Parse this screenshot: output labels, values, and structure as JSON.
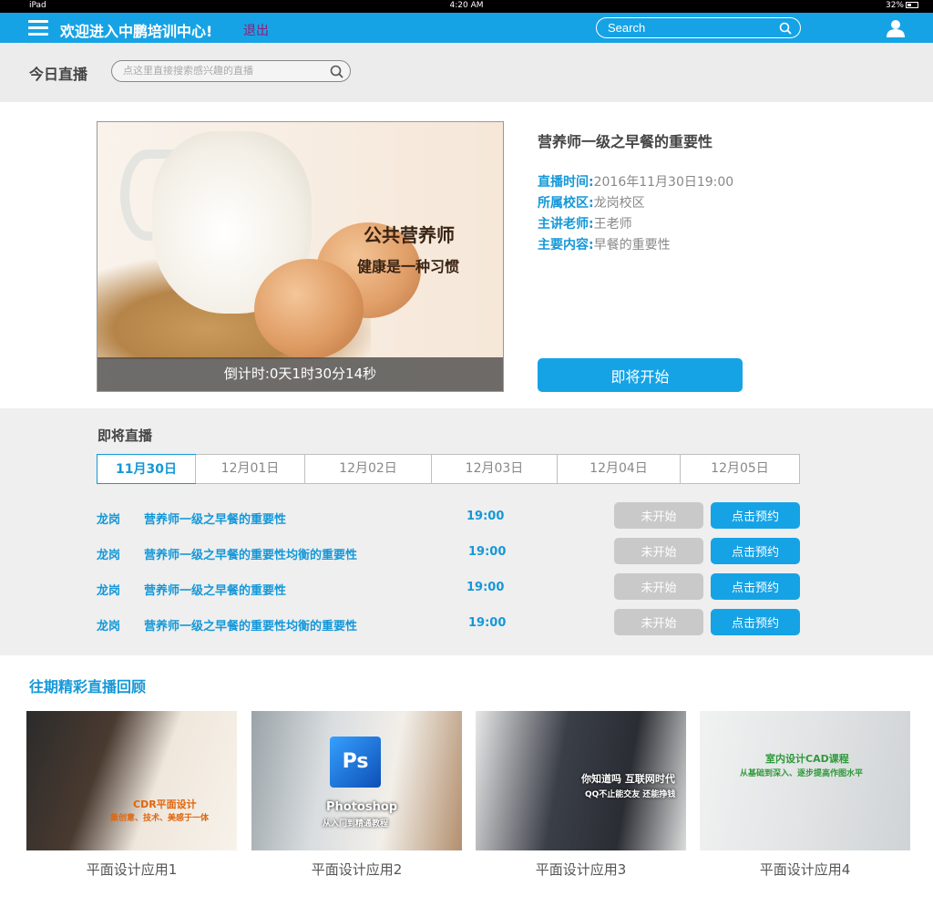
{
  "status_bar": {
    "device": "iPad",
    "time": "4:20 AM",
    "battery": "32%"
  },
  "topnav": {
    "welcome": "欢迎进入中鹏培训中心!",
    "logout": "退出",
    "search_placeholder": "Search"
  },
  "live_search": {
    "title": "今日直播",
    "placeholder": "点这里直接搜索感兴趣的直播"
  },
  "featured": {
    "poster_headline": "公共营养师",
    "poster_subline": "健康是一种习惯",
    "countdown": "倒计时:0天1时30分14秒",
    "title": "营养师一级之早餐的重要性",
    "rows": [
      {
        "key": "直播时间:",
        "value": "2016年11月30日19:00"
      },
      {
        "key": "所属校区:",
        "value": "龙岗校区"
      },
      {
        "key": "主讲老师:",
        "value": "王老师"
      },
      {
        "key": "主要内容:",
        "value": "早餐的重要性"
      }
    ],
    "start_button": "即将开始"
  },
  "upcoming": {
    "title": "即将直播",
    "tabs": [
      "11月30日",
      "12月01日",
      "12月02日",
      "12月03日",
      "12月04日",
      "12月05日"
    ],
    "active_tab": 0,
    "rows": [
      {
        "campus": "龙岗",
        "course": "营养师一级之早餐的重要性",
        "time": "19:00",
        "status": "未开始",
        "action": "点击预约"
      },
      {
        "campus": "龙岗",
        "course": "营养师一级之早餐的重要性均衡的重要性",
        "time": "19:00",
        "status": "未开始",
        "action": "点击预约"
      },
      {
        "campus": "龙岗",
        "course": "营养师一级之早餐的重要性",
        "time": "19:00",
        "status": "未开始",
        "action": "点击预约"
      },
      {
        "campus": "龙岗",
        "course": "营养师一级之早餐的重要性均衡的重要性",
        "time": "19:00",
        "status": "未开始",
        "action": "点击预约"
      }
    ]
  },
  "review": {
    "title": "往期精彩直播回顾",
    "cards": [
      {
        "caption": "平面设计应用1",
        "thumb_text": "CDR平面设计",
        "thumb_sub": "集创意、技术、美感于一体"
      },
      {
        "caption": "平面设计应用2",
        "thumb_text": "Photoshop",
        "thumb_sub": "从入门到精通教程",
        "badge": "Ps"
      },
      {
        "caption": "平面设计应用3",
        "thumb_text": "你知道吗 互联网时代",
        "thumb_sub": "QQ不止能交友 还能挣钱"
      },
      {
        "caption": "平面设计应用4",
        "thumb_text": "室内设计CAD课程",
        "thumb_sub": "从基础到深入、逐步提高作图水平"
      }
    ]
  },
  "colors": {
    "accent": "#16a3e6",
    "link": "#1598d8",
    "disabled": "#c9c9c9"
  }
}
